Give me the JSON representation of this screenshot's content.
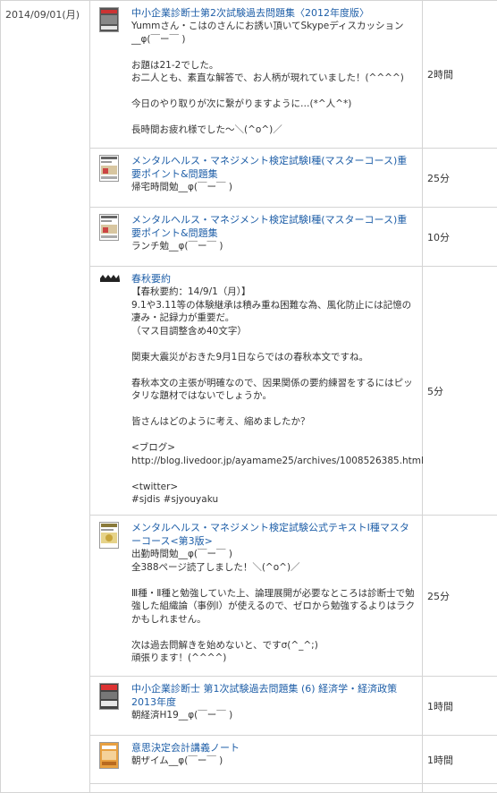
{
  "date": "2014/09/01(月)",
  "entries": [
    {
      "title": "中小企業診断士第2次試験過去問題集〈2012年度版〉",
      "memo": "Yummさん・こはのさんにお誘い頂いてSkypeディスカッション__φ(￣ー￣ )\n\nお題は21-2でした。\nお二人とも、素直な解答で、お人柄が現れていました！(^^^^)\n\n今日のやり取りが次に繋がりますように…(*^人^*)\n\n長時間お疲れ様でした～＼(^o^)／",
      "time": "2時間"
    },
    {
      "title": "メンタルヘルス・マネジメント検定試験Ⅰ種(マスターコース)重要ポイント&問題集",
      "memo": "帰宅時間勉__φ(￣ー￣ )",
      "time": "25分"
    },
    {
      "title": "メンタルヘルス・マネジメント検定試験Ⅰ種(マスターコース)重要ポイント&問題集",
      "memo": "ランチ勉__φ(￣ー￣ )",
      "time": "10分"
    },
    {
      "title": "春秋要約",
      "memo": "【春秋要約：14/9/1（月）】\n9.1や3.11等の体験継承は積み重ね困難な為、風化防止には記憶の凄み・記録力が重要だ。\n（マス目調整含め40文字）\n\n関東大震災がおきた9月1日ならではの春秋本文ですね。\n\n春秋本文の主張が明確なので、因果関係の要約練習をするにはピッタリな題材ではないでしょうか。\n\n皆さんはどのように考え、縮めましたか？\n\n<ブログ>\nhttp://blog.livedoor.jp/ayamame25/archives/1008526385.html\n\n<twitter>\n#sjdis #sjyouyaku",
      "time": "5分"
    },
    {
      "title": "メンタルヘルス・マネジメント検定試験公式テキストⅠ種マスターコース<第3版>",
      "memo": "出勤時間勉__φ(￣ー￣ )\n全388ページ読了しました！＼(^o^)／\n\nⅢ種・Ⅱ種と勉強していた上、論理展開が必要なところは診断士で勉強した組織論（事例Ⅰ）が使えるので、ゼロから勉強するよりはラクかもしれません。\n\n次は過去問解きを始めないと、ですσ(^_^;)\n頑張ります！(^^^^)",
      "time": "25分"
    },
    {
      "title": "中小企業診断士 第1次試験過去問題集 (6) 経済学・経済政策 2013年度",
      "memo": "朝経済H19__φ(￣ー￣ )",
      "time": "1時間"
    },
    {
      "title": "意思決定会計講義ノート",
      "memo": "朝ザイム__φ(￣ー￣ )",
      "time": "1時間"
    }
  ]
}
